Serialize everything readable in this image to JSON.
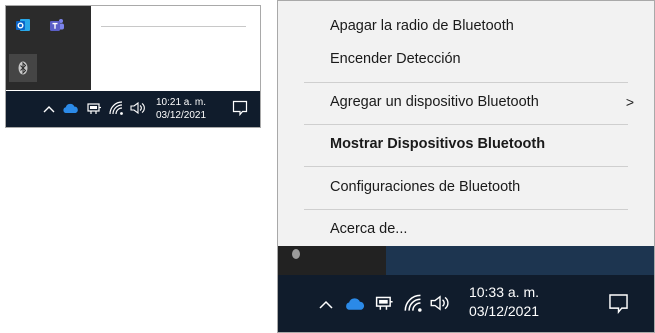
{
  "left_panel": {
    "tray_icons": [
      {
        "name": "outlook-icon",
        "label": "o",
        "color": "#0a64c8"
      },
      {
        "name": "teams-icon",
        "label": "T",
        "color": "#5b5fc7"
      },
      {
        "name": "bluetooth-icon",
        "color": "#c8c8c8"
      }
    ],
    "taskbar": {
      "time": "10:21 a. m.",
      "date": "03/12/2021"
    }
  },
  "context_menu": {
    "items": [
      {
        "label": "Apagar la radio de Bluetooth",
        "bold": false
      },
      {
        "label": "Encender Detección",
        "bold": false
      },
      {
        "label": "Agregar un dispositivo Bluetooth",
        "bold": false,
        "submenu_indicator": ">"
      },
      {
        "label": "Mostrar Dispositivos Bluetooth",
        "bold": true
      },
      {
        "label": "Configuraciones de Bluetooth",
        "bold": false
      },
      {
        "label": "Acerca de...",
        "bold": false
      }
    ]
  },
  "right_panel": {
    "taskbar": {
      "time": "10:33 a. m.",
      "date": "03/12/2021"
    }
  },
  "colors": {
    "taskbar": "#101c2c",
    "onedrive": "#2b8ae8",
    "menu_bg": "#f2f2f2",
    "menu_text": "#1a1a1a"
  }
}
